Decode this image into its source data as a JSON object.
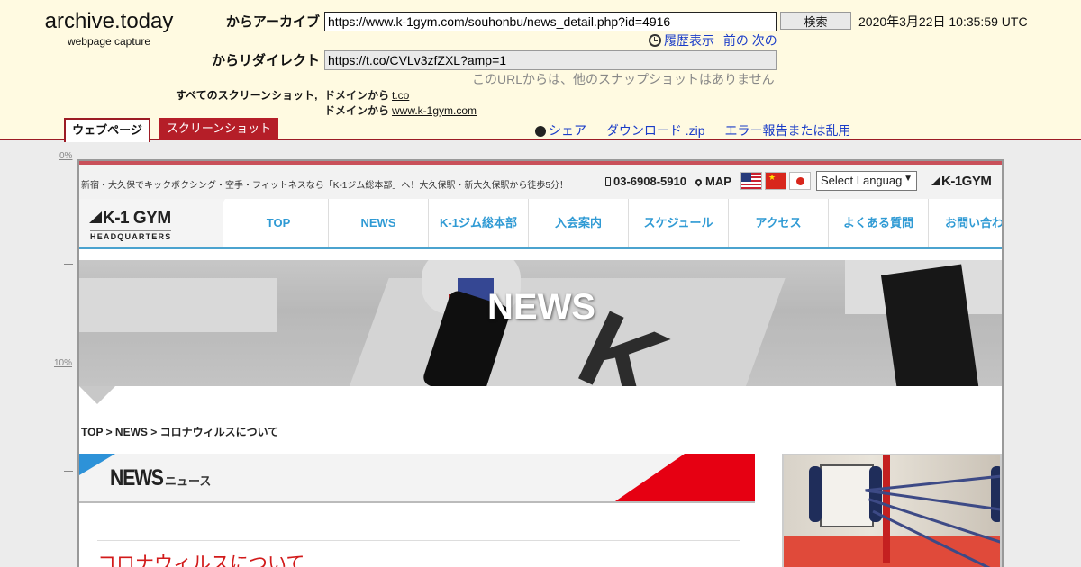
{
  "archive": {
    "brand_title": "archive.today",
    "brand_sub": "webpage capture",
    "from_archive_label": "からアーカイブ",
    "url_value": "https://www.k-1gym.com/souhonbu/news_detail.php?id=4916",
    "search_button": "検索",
    "snapshot_date": "2020年3月22日 10:35:59 UTC",
    "history_link": "履歴表示",
    "prev_link": "前の",
    "next_link": "次の",
    "redirect_label": "からリダイレクト",
    "redirect_value": "https://t.co/CVLv3zfZXL?amp=1",
    "no_other_snapshots": "このURLからは、他のスナップショットはありません",
    "all_screenshots": "すべてのスクリーンショット,",
    "domain_from": "ドメインから",
    "domain1": "t.co",
    "domain2": "www.k-1gym.com",
    "tab_webpage": "ウェブページ",
    "tab_screenshot": "スクリーンショット",
    "share_link": "シェア",
    "download_link": "ダウンロード .zip",
    "report_link": "エラー報告または乱用"
  },
  "ruler": {
    "zero": "0%",
    "ten": "10%"
  },
  "site": {
    "tagline": "新宿・大久保でキックボクシング・空手・フィットネスなら「K-1ジム総本部」へ！大久保駅・新大久保駅から徒歩5分！",
    "phone": "03-6908-5910",
    "map": "MAP",
    "language_select": "Select Languag",
    "top_logo": "K-1GYM",
    "logo_main": "K-1 GYM",
    "logo_sub": "HEADQUARTERS",
    "nav": [
      "TOP",
      "NEWS",
      "K-1ジム総本部",
      "入会案内",
      "スケジュール",
      "アクセス",
      "よくある質問",
      "お問い合わせ"
    ],
    "hero_title": "NEWS",
    "breadcrumb": "TOP > NEWS > コロナウィルスについて",
    "band_title": "NEWS",
    "band_sub": "ニュース",
    "article_title": "コロナウィルスについて"
  },
  "colors": {
    "archive_bg": "#fffae1",
    "archive_red": "#9c1b25",
    "link_blue": "#1a3cc8",
    "nav_blue": "#2f9ad4",
    "k1_red": "#e60012",
    "title_red": "#d21a1a"
  },
  "icons": {
    "history": "history-clock-icon",
    "share": "share-icon",
    "phone": "phone-icon",
    "map": "map-pin-icon"
  }
}
